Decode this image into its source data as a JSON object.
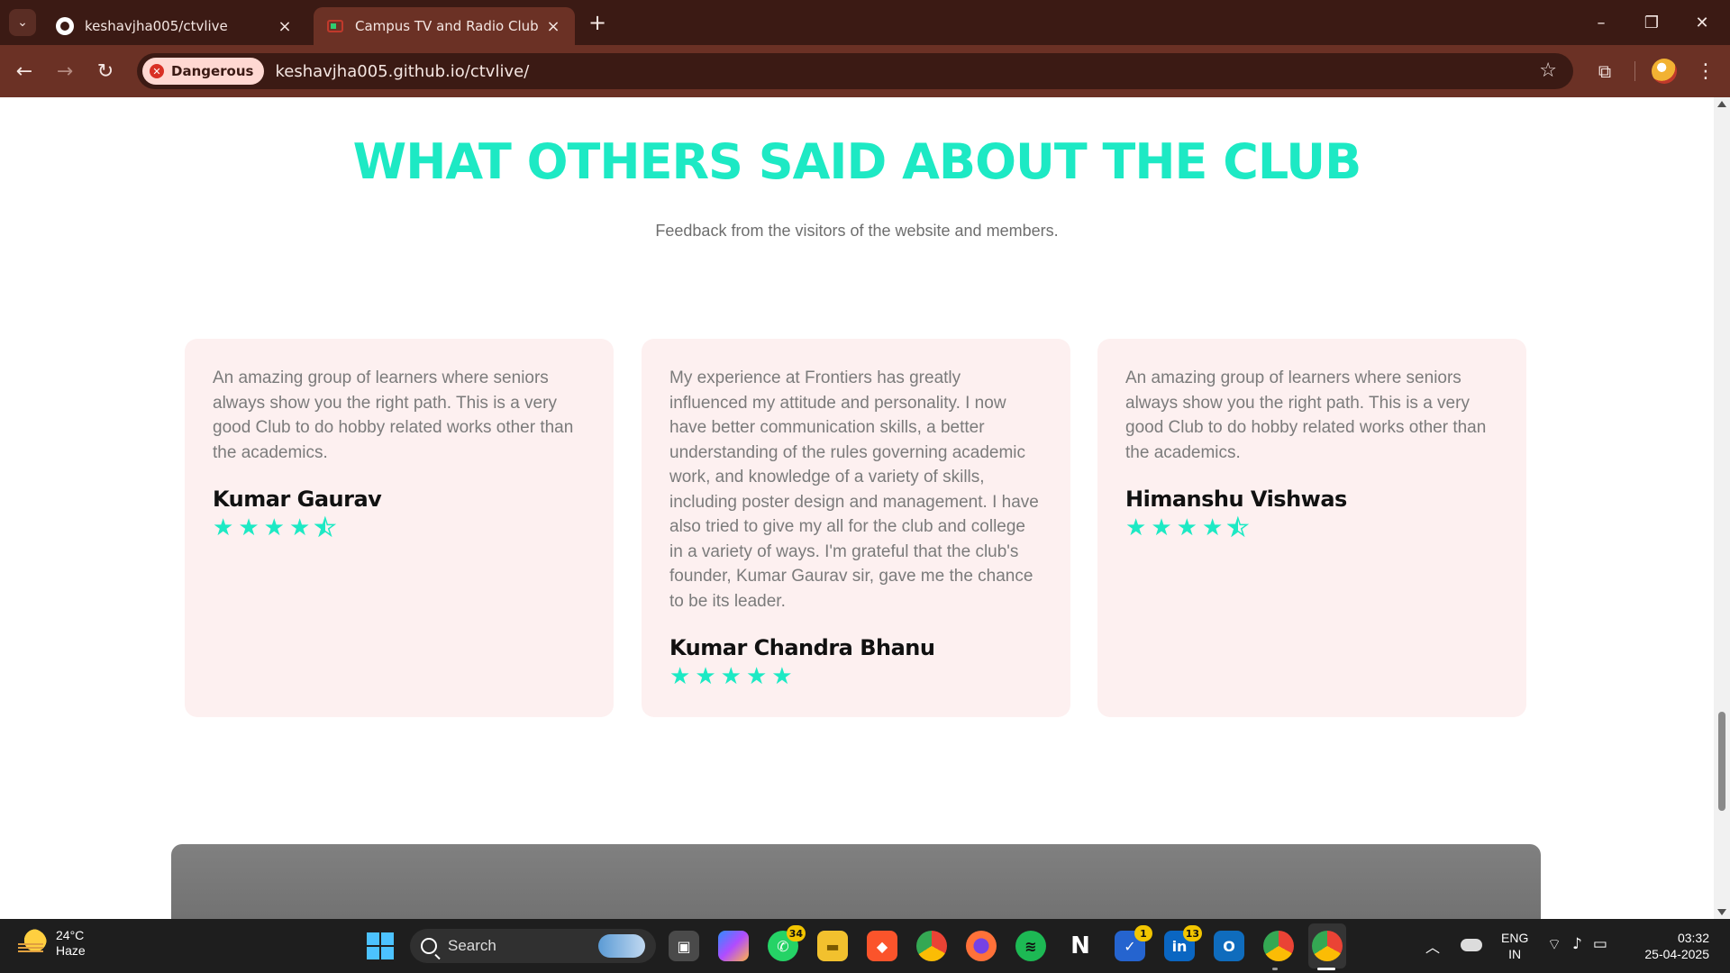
{
  "browser": {
    "tabs": [
      {
        "title": "keshavjha005/ctvlive",
        "icon": "github-icon",
        "active": false
      },
      {
        "title": "Campus TV and Radio Club",
        "icon": "tv-icon",
        "active": true
      }
    ],
    "security_label": "Dangerous",
    "url": "keshavjha005.github.io/ctvlive/"
  },
  "section": {
    "title": "WHAT OTHERS SAID ABOUT THE CLUB",
    "subtitle": "Feedback from the visitors of the website and members."
  },
  "testimonials": [
    {
      "quote": "An amazing group of learners where seniors always show you the right path. This is a very good Club to do hobby related works other than the academics.",
      "name": "Kumar Gaurav",
      "rating": 4.5
    },
    {
      "quote": "My experience at Frontiers has greatly influenced my attitude and personality. I now have better communication skills, a better understanding of the rules governing academic work, and knowledge of a variety of skills, including poster design and management. I have also tried to give my all for the club and college in a variety of ways. I'm grateful that the club's founder, Kumar Gaurav sir, gave me the chance to be its leader.",
      "name": "Kumar Chandra Bhanu",
      "rating": 5
    },
    {
      "quote": "An amazing group of learners where seniors always show you the right path. This is a very good Club to do hobby related works other than the academics.",
      "name": "Himanshu Vishwas",
      "rating": 4.5
    }
  ],
  "colors": {
    "accent": "#1de9c4",
    "card_bg": "#fdf0f0",
    "chrome_dark": "#3b1a14",
    "chrome_toolbar": "#6b3125"
  },
  "taskbar": {
    "weather_temp": "24°C",
    "weather_desc": "Haze",
    "search_label": "Search",
    "badges": {
      "whatsapp": "34",
      "todo": "1",
      "linkedin": "13"
    },
    "lang_top": "ENG",
    "lang_bottom": "IN",
    "time": "03:32",
    "date": "25-04-2025"
  }
}
